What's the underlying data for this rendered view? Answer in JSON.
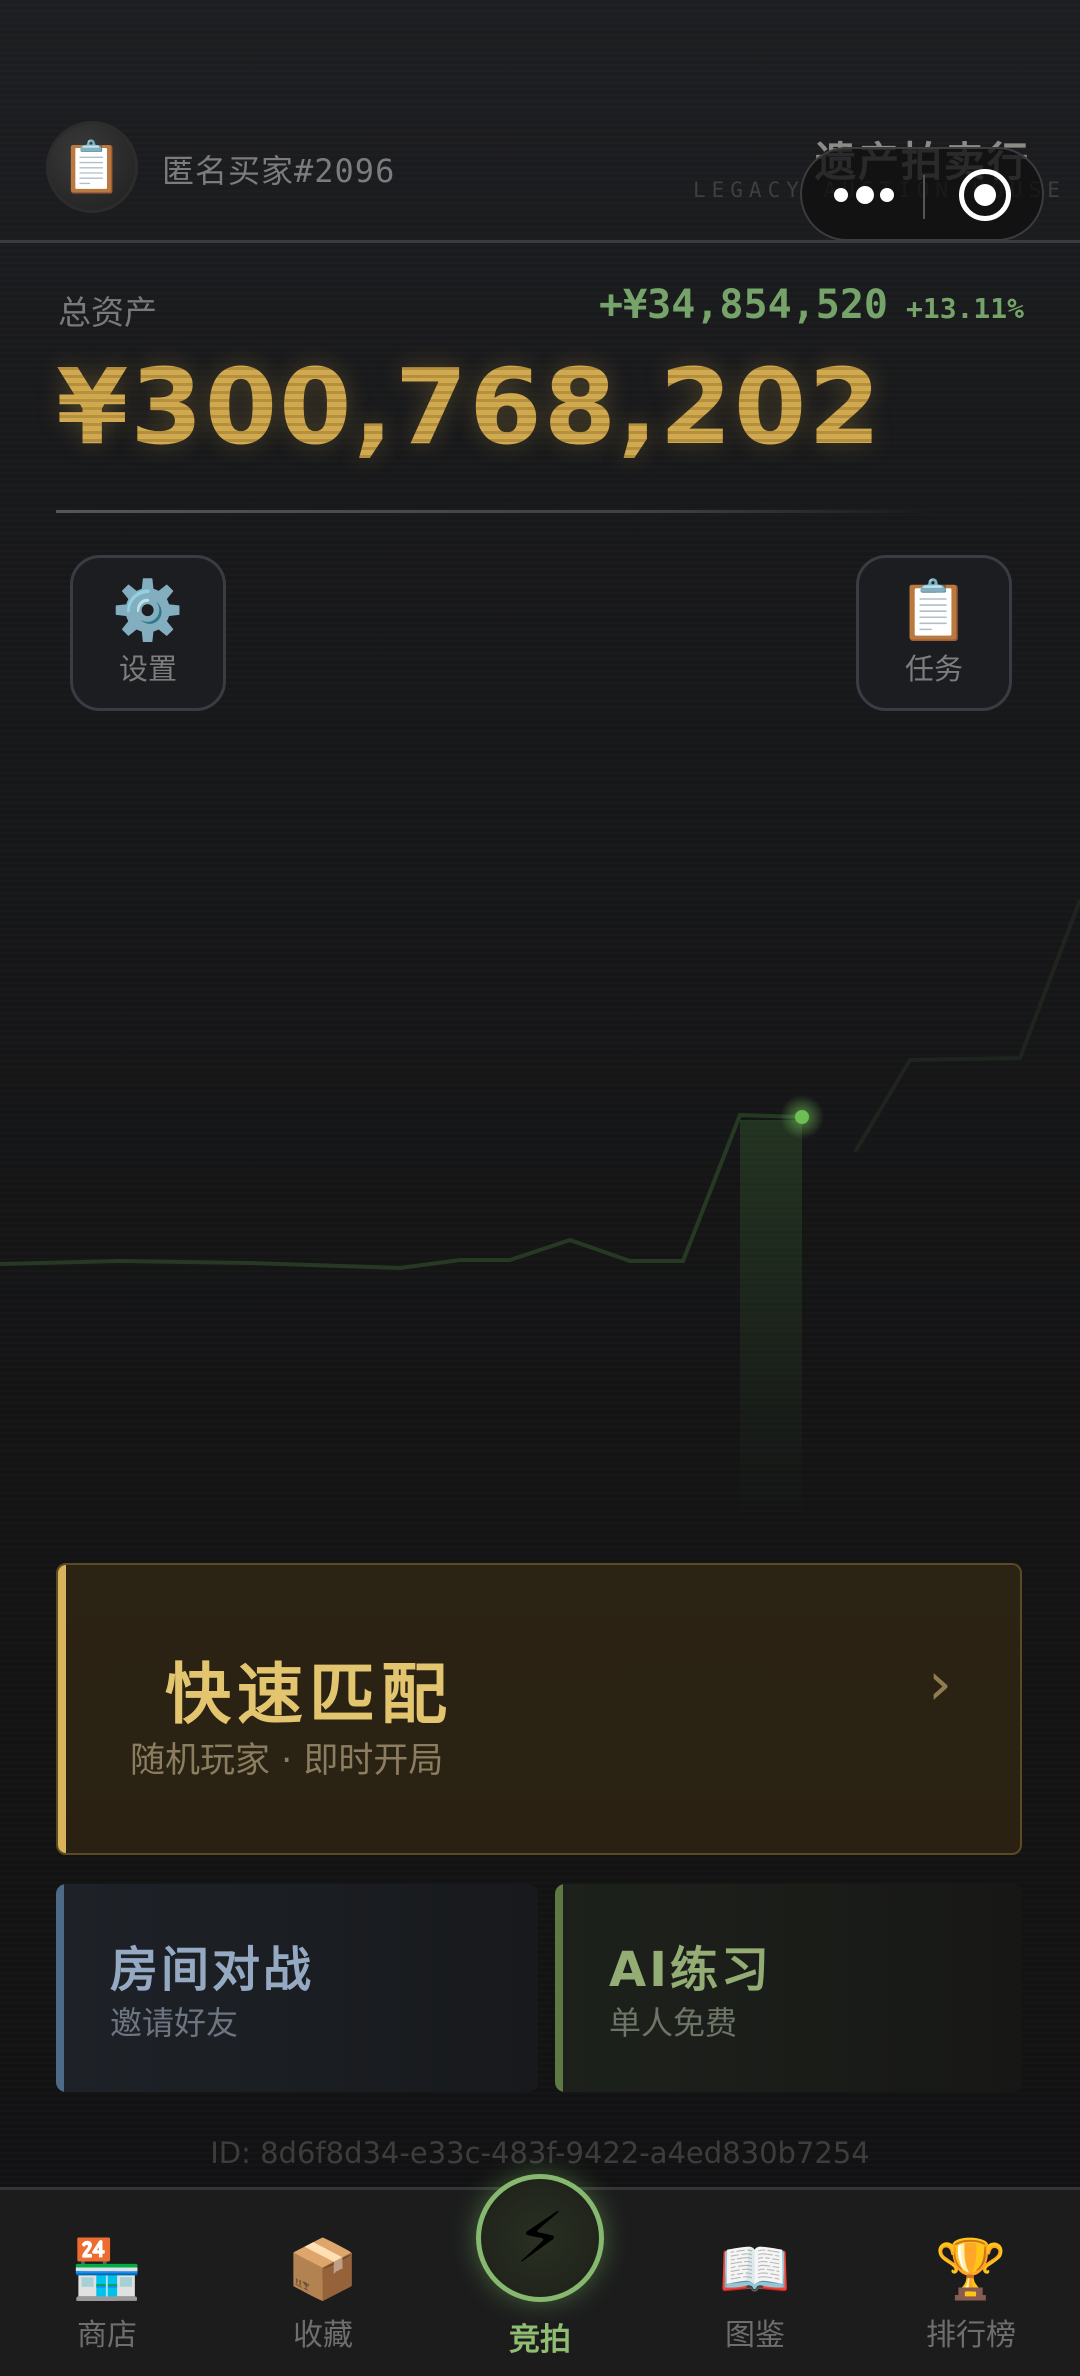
{
  "header": {
    "avatar_icon": "clipboard-icon",
    "username": "匿名买家#2096",
    "brand_title": "遗产拍卖行",
    "brand_subtitle": "LEGACY AUCTION HOUSE"
  },
  "assets": {
    "label": "总资产",
    "change_amount": "+¥34,854,520",
    "change_percent": "+13.11%",
    "total": "¥300,768,202",
    "colors": {
      "gold": "#c9a24b",
      "gain": "#76a36a"
    }
  },
  "side_buttons": {
    "settings": {
      "icon": "⚙️",
      "label": "设置"
    },
    "tasks": {
      "icon": "📋",
      "label": "任务"
    }
  },
  "modes": {
    "quick_match": {
      "title": "快速匹配",
      "subtitle": "随机玩家 · 即时开局",
      "arrow": "›"
    },
    "room_battle": {
      "title": "房间对战",
      "subtitle": "邀请好友"
    },
    "ai_practice": {
      "title": "AI练习",
      "subtitle": "单人免费"
    }
  },
  "user_id": "ID: 8d6f8d34-e33c-483f-9422-a4ed830b7254",
  "nav": {
    "shop": {
      "icon": "🏪",
      "label": "商店"
    },
    "collection": {
      "icon": "📦",
      "label": "收藏"
    },
    "auction": {
      "icon": "⚡",
      "label": "竞拍"
    },
    "catalog": {
      "icon": "📖",
      "label": "图鉴"
    },
    "leaderboard": {
      "icon": "🏆",
      "label": "排行榜"
    }
  }
}
